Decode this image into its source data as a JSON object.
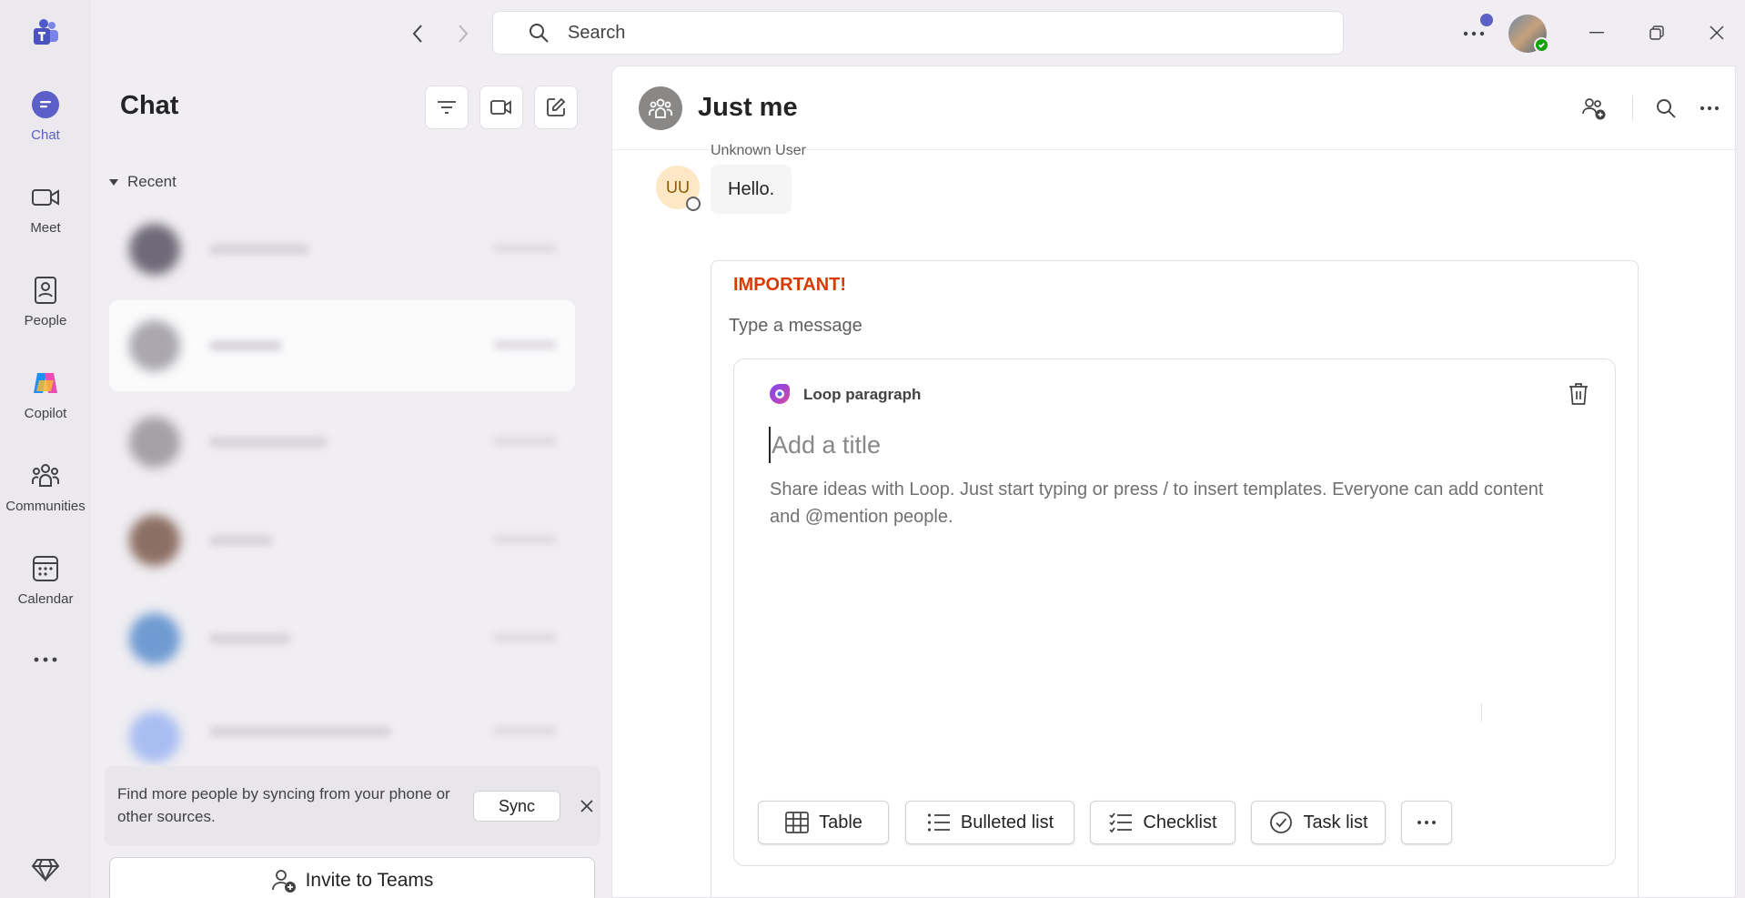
{
  "rail": {
    "items": [
      {
        "label": "Chat"
      },
      {
        "label": "Meet"
      },
      {
        "label": "People"
      },
      {
        "label": "Copilot"
      },
      {
        "label": "Communities"
      },
      {
        "label": "Calendar"
      }
    ],
    "accent": "#5b5fc7"
  },
  "search": {
    "placeholder": "Search"
  },
  "chat_list": {
    "title": "Chat",
    "section": "Recent",
    "sync": {
      "text": "Find more people by syncing from your phone or other sources.",
      "button": "Sync"
    },
    "invite": "Invite to Teams"
  },
  "conversation": {
    "title": "Just me",
    "message": {
      "sender": "Unknown User",
      "initials": "UU",
      "text": "Hello."
    }
  },
  "compose": {
    "priority": "IMPORTANT!",
    "priority_color": "#d83b01",
    "placeholder": "Type a message",
    "loop": {
      "label": "Loop paragraph",
      "title_placeholder": "Add a title",
      "body": "Share ideas with Loop. Just start typing or press / to insert templates. Everyone can add content and @mention people."
    },
    "insert_buttons": [
      {
        "label": "Table",
        "icon": "table-icon"
      },
      {
        "label": "Bulleted list",
        "icon": "bulleted-list-icon"
      },
      {
        "label": "Checklist",
        "icon": "checklist-icon"
      },
      {
        "label": "Task list",
        "icon": "task-list-icon"
      }
    ]
  }
}
